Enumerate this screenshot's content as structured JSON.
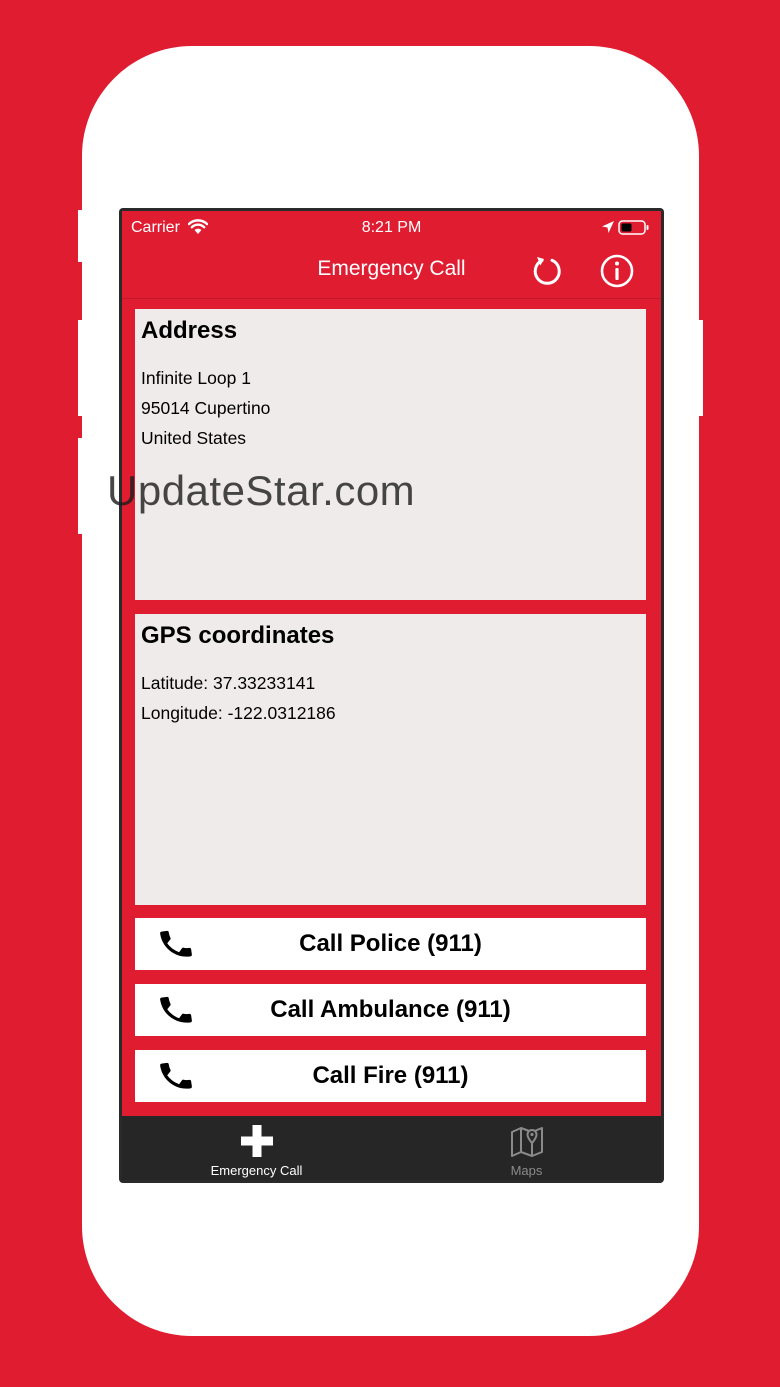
{
  "status_bar": {
    "carrier": "Carrier",
    "time": "8:21 PM"
  },
  "nav": {
    "title": "Emergency Call"
  },
  "address": {
    "title": "Address",
    "lines": [
      "Infinite Loop 1",
      "95014 Cupertino",
      "United States"
    ]
  },
  "gps": {
    "title": "GPS coordinates",
    "latitude": "Latitude: 37.33233141",
    "longitude": "Longitude: -122.0312186"
  },
  "watermark": "UpdateStar.com",
  "calls": {
    "police": "Call Police (911)",
    "ambulance": "Call Ambulance (911)",
    "fire": "Call Fire (911)"
  },
  "tabs": [
    {
      "label": "Emergency Call",
      "icon": "plus-icon"
    },
    {
      "label": "Maps",
      "icon": "map-icon"
    }
  ],
  "colors": {
    "brand_red": "#e01c31",
    "card_bg": "#efebea",
    "tab_bar": "#262626"
  }
}
